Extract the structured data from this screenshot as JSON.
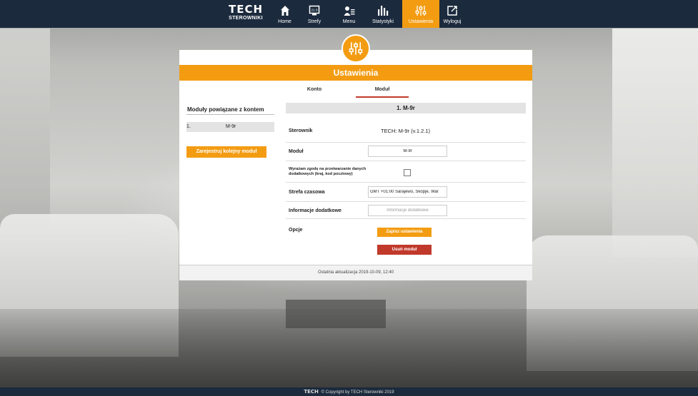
{
  "nav": {
    "logo_main": "TECH",
    "logo_sub": "STEROWNIKI",
    "items": [
      {
        "label": "Home",
        "icon": "home-icon"
      },
      {
        "label": "Strefy",
        "icon": "zones-icon"
      },
      {
        "label": "Menu",
        "icon": "menu-user-icon"
      },
      {
        "label": "Statystyki",
        "icon": "bar-chart-icon"
      },
      {
        "label": "Ustawienia",
        "icon": "sliders-icon",
        "active": true
      },
      {
        "label": "Wyloguj",
        "icon": "logout-icon"
      }
    ],
    "zones_icon_text": "21.0"
  },
  "card": {
    "title": "Ustawienia",
    "tabs": [
      {
        "label": "Konto"
      },
      {
        "label": "Moduł",
        "active": true
      }
    ],
    "left": {
      "title": "Moduły powiązane z kontem",
      "modules": [
        {
          "num": "1.",
          "name": "M-9r"
        }
      ],
      "register_button": "Zarejestruj kolejny moduł"
    },
    "module": {
      "title": "1. M-9r",
      "controller_label": "Sterownik",
      "controller_value": "TECH: M-9r (v.1.2.1)",
      "module_label": "Moduł",
      "module_value": "M-9r",
      "consent_label": "Wyrażam zgodę na przetwarzanie danych dodatkowych (kraj, kod pocztowy)",
      "timezone_label": "Strefa czasowa",
      "timezone_value": "GMT +01:00 Sarajewo, Skopje, War",
      "extra_label": "Informacje dodatkowe",
      "extra_placeholder": "Informacje dodatkowe",
      "options_label": "Opcje",
      "save_button": "Zapisz ustawienia",
      "delete_button": "Usuń moduł"
    },
    "footer": "Ostatnia aktualizacja 2019-10-09, 12:40"
  },
  "footer": {
    "logo": "TECH",
    "copyright": "© Copyright by TECH Sterowniki 2019"
  },
  "colors": {
    "accent": "#f39c12",
    "nav_bg": "#1b2a3d",
    "danger": "#c0392b"
  }
}
